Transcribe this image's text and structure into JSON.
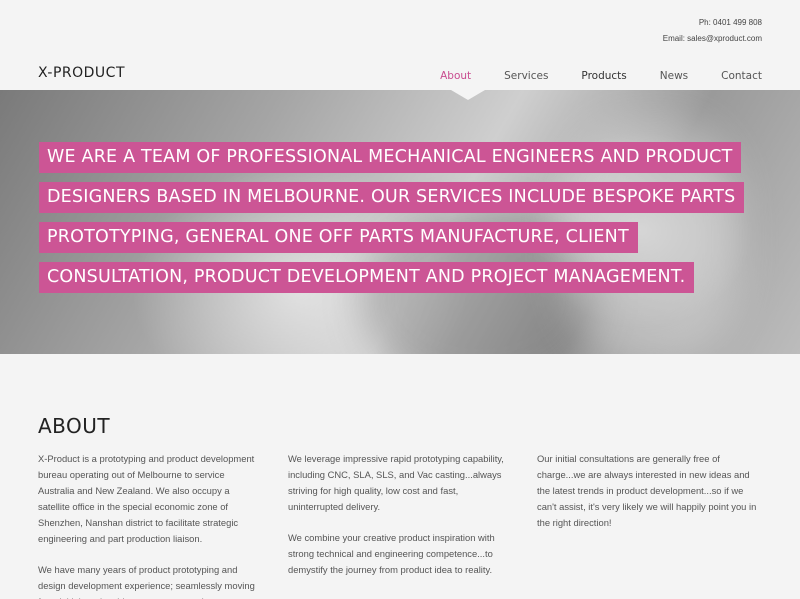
{
  "header": {
    "phone": "Ph: 0401 499 808",
    "email": "Email: sales@xproduct.com",
    "logo": "X-PRODUCT",
    "nav": [
      {
        "label": "About",
        "active": true
      },
      {
        "label": "Services",
        "active": false
      },
      {
        "label": "Products",
        "active": false
      },
      {
        "label": "News",
        "active": false
      },
      {
        "label": "Contact",
        "active": false
      }
    ]
  },
  "hero": {
    "lines": [
      "WE ARE A TEAM OF PROFESSIONAL MECHANICAL ENGINEERS AND PRODUCT",
      "DESIGNERS BASED IN MELBOURNE. OUR SERVICES INCLUDE BESPOKE PARTS",
      "PROTOTYPING, GENERAL ONE OFF PARTS MANUFACTURE, CLIENT",
      "CONSULTATION, PRODUCT DEVELOPMENT AND PROJECT MANAGEMENT."
    ],
    "highlight_color": "#cc5595"
  },
  "about": {
    "heading": "ABOUT",
    "col1": [
      "X-Product is a prototyping and product development bureau operating out of Melbourne to service Australia and New Zealand. We also occupy a satellite office in the special economic zone of Shenzhen, Nanshan district to facilitate strategic engineering and part production liaison.",
      "We have many years of product prototyping and design development experience; seamlessly moving from initial product ideas to concept and"
    ],
    "col2": [
      "We leverage impressive rapid prototyping capability, including CNC, SLA, SLS, and Vac casting...always striving for high quality, low cost and fast, uninterrupted delivery.",
      "We combine your creative product inspiration with strong technical and engineering competence...to demystify the journey from product idea to reality."
    ],
    "col3": [
      "Our initial consultations are generally free of charge...we are always interested in new ideas and the latest trends in product development...so if we can't assist, it's very likely we  will happily point you in the right direction!"
    ]
  },
  "colors": {
    "accent": "#c94c8f",
    "background": "#f4f4f4"
  }
}
